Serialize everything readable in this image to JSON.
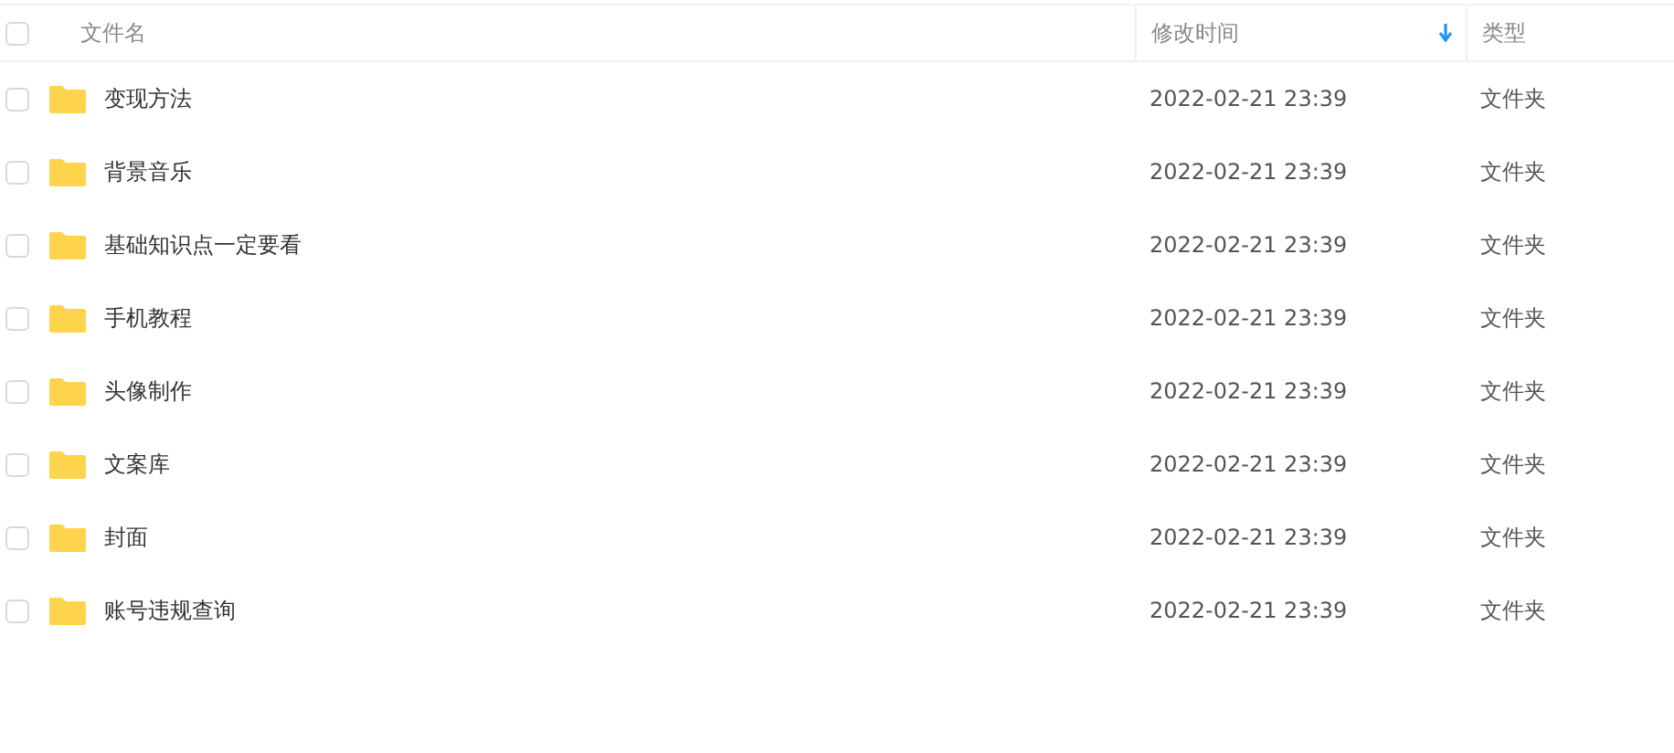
{
  "table": {
    "select_all": {
      "checked": false
    },
    "columns": [
      {
        "label": "文件名",
        "sorted": false
      },
      {
        "label": "修改时间",
        "sorted": true
      },
      {
        "label": "类型",
        "sorted": false
      }
    ],
    "rows": [
      {
        "checked": false,
        "name": "变现方法",
        "modified": "2022-02-21 23:39",
        "type": "文件夹"
      },
      {
        "checked": false,
        "name": "背景音乐",
        "modified": "2022-02-21 23:39",
        "type": "文件夹"
      },
      {
        "checked": false,
        "name": "基础知识点一定要看",
        "modified": "2022-02-21 23:39",
        "type": "文件夹"
      },
      {
        "checked": false,
        "name": "手机教程",
        "modified": "2022-02-21 23:39",
        "type": "文件夹"
      },
      {
        "checked": false,
        "name": "头像制作",
        "modified": "2022-02-21 23:39",
        "type": "文件夹"
      },
      {
        "checked": false,
        "name": "文案库",
        "modified": "2022-02-21 23:39",
        "type": "文件夹"
      },
      {
        "checked": false,
        "name": "封面",
        "modified": "2022-02-21 23:39",
        "type": "文件夹"
      },
      {
        "checked": false,
        "name": "账号违规查询",
        "modified": "2022-02-21 23:39",
        "type": "文件夹"
      }
    ]
  }
}
